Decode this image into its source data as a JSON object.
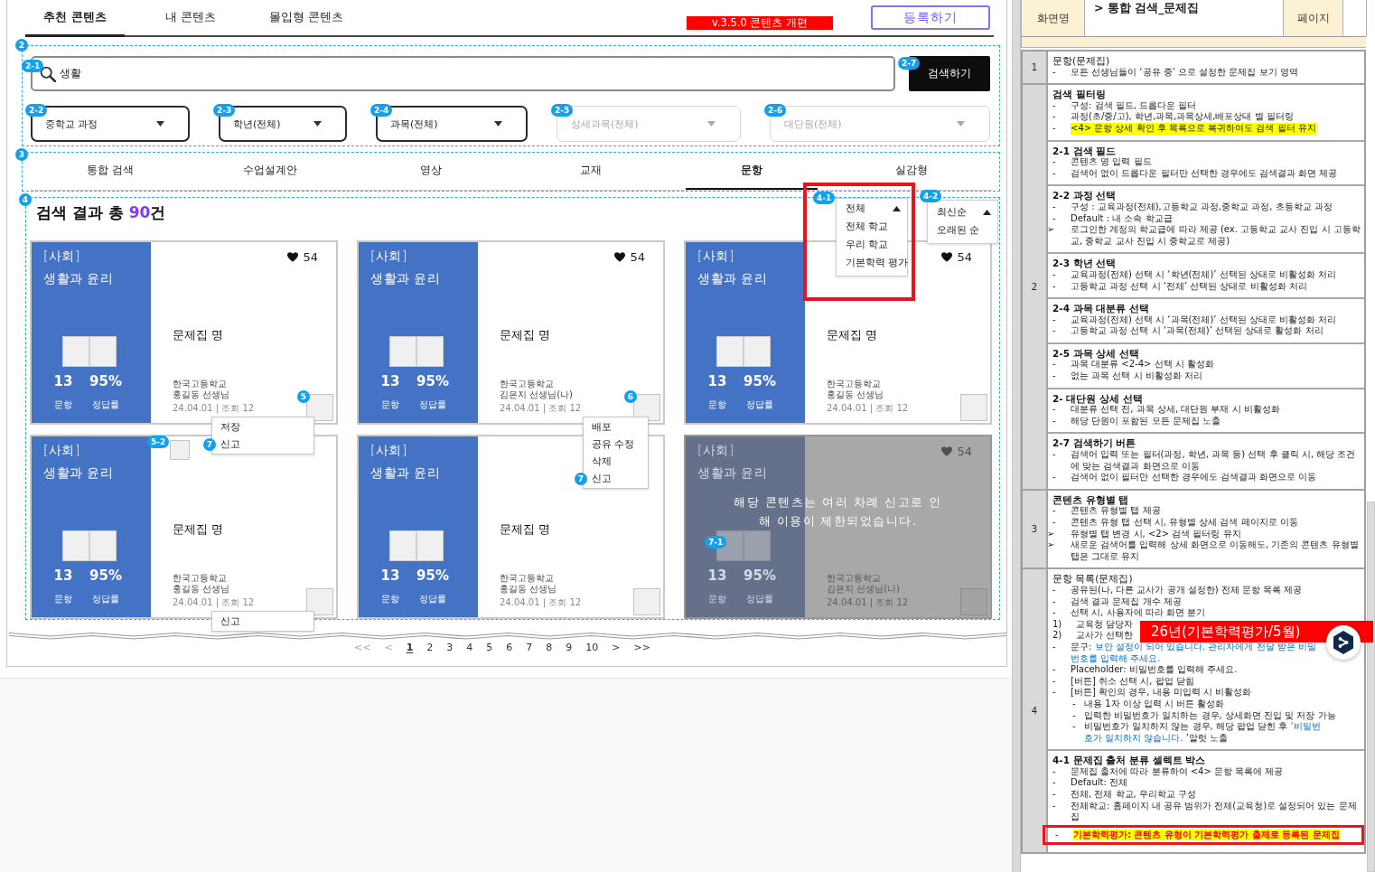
{
  "top_tabs": [
    {
      "label": "추천 콘텐츠",
      "selected": true
    },
    {
      "label": "내 콘텐츠",
      "selected": false
    },
    {
      "label": "몰입형 콘텐츠",
      "selected": false
    }
  ],
  "version_label": "v.3.5.0 콘텐츠 개편",
  "register_button": "등록하기",
  "search_area": {
    "badge": "2",
    "search_field": {
      "badge": "2-1",
      "value": "생활"
    },
    "search_button": {
      "badge": "2-7",
      "label": "검색하기"
    },
    "filters": [
      {
        "badge": "2-2",
        "value": "중학교 과정",
        "disabled": false
      },
      {
        "badge": "2-3",
        "value": "학년(전체)",
        "disabled": false
      },
      {
        "badge": "2-4",
        "value": "과목(전체)",
        "disabled": false
      },
      {
        "badge": "2-5",
        "value": "상세과목(전체)",
        "disabled": true
      },
      {
        "badge": "2-6",
        "value": "대단원(전체)",
        "disabled": true
      }
    ]
  },
  "type_tabs": {
    "badge": "3",
    "tabs": [
      {
        "label": "통합 검색",
        "selected": false
      },
      {
        "label": "수업설계안",
        "selected": false
      },
      {
        "label": "영상",
        "selected": false
      },
      {
        "label": "교재",
        "selected": false
      },
      {
        "label": "문항",
        "selected": true
      },
      {
        "label": "실감형",
        "selected": false
      }
    ]
  },
  "results": {
    "badge": "4",
    "summary": {
      "prefix": "검색 결과 총 ",
      "count": "90",
      "suffix": "건"
    },
    "source_select": {
      "badge": "4-1",
      "value": "전체",
      "expanded": true,
      "options": [
        "전체 학교",
        "우리 학교",
        "기본학력 평가"
      ]
    },
    "sort_select": {
      "badge": "4-2",
      "value": "최신순",
      "expanded": true,
      "options": [
        "오래된 순"
      ]
    },
    "cards": [
      {
        "subject": "[사회]",
        "title": "생활과 윤리",
        "question_count": "13",
        "accuracy": "95%",
        "question_label": "문항",
        "accuracy_label": "정답률",
        "likes": "54",
        "name": "문제집 명",
        "school": "한국고등학교",
        "teacher": "홍길동 선생님",
        "meta": "24.04.01 | 조회 12",
        "restricted": false,
        "square_badge": "5",
        "menu": {
          "items": [
            {
              "label": "저장"
            },
            {
              "label": "신고",
              "badge": "7"
            }
          ]
        }
      },
      {
        "subject": "[사회]",
        "title": "생활과 윤리",
        "question_count": "13",
        "accuracy": "95%",
        "question_label": "문항",
        "accuracy_label": "정답률",
        "likes": "54",
        "name": "문제집 명",
        "school": "한국고등학교",
        "teacher": "김은지 선생님(나)",
        "meta": "24.04.01 | 조회 12",
        "restricted": false,
        "square_badge": "6",
        "menu": {
          "items": [
            {
              "label": "배포"
            },
            {
              "label": "공유 수정"
            },
            {
              "label": "삭제"
            },
            {
              "label": "신고",
              "badge": "7"
            }
          ]
        }
      },
      {
        "subject": "[사회]",
        "title": "생활과 윤리",
        "question_count": "13",
        "accuracy": "95%",
        "question_label": "문항",
        "accuracy_label": "정답률",
        "likes": "54",
        "name": "문제집 명",
        "school": "한국고등학교",
        "teacher": "홍길동 선생님",
        "meta": "24.04.01 | 조회 12",
        "restricted": false
      },
      {
        "subject": "[사회]",
        "title": "생활과 윤리",
        "question_count": "13",
        "accuracy": "95%",
        "question_label": "문항",
        "accuracy_label": "정답률",
        "name": "문제집 명",
        "school": "한국고등학교",
        "teacher": "홍길동 선생님",
        "meta": "24.04.01 | 조회 12",
        "restricted": false,
        "corner_box": {
          "badge": "5-2"
        },
        "menu": {
          "items": [
            {
              "label": "신고"
            }
          ]
        }
      },
      {
        "subject": "[사회]",
        "title": "생활과 윤리",
        "question_count": "13",
        "accuracy": "95%",
        "question_label": "문항",
        "accuracy_label": "정답률",
        "name": "문제집 명",
        "school": "한국고등학교",
        "teacher": "홍길동 선생님",
        "meta": "24.04.01 | 조회 12",
        "restricted": false
      },
      {
        "subject": "[사회]",
        "title": "생활과 윤리",
        "question_count": "13",
        "accuracy": "95%",
        "question_label": "문항",
        "accuracy_label": "정답률",
        "likes": "54",
        "school": "한국고등학교",
        "teacher": "김은지 선생님(나)",
        "meta": "24.04.01 | 조회 12",
        "restricted": true,
        "notice": {
          "badge": "7-1",
          "text": "해당 콘텐츠는 여러 차례 신고로 인해 이용이 제한되었습니다."
        }
      }
    ]
  },
  "pagination": {
    "first": "<<",
    "prev": "<",
    "pages": [
      {
        "label": "1",
        "selected": true
      },
      {
        "label": "2",
        "selected": false
      },
      {
        "label": "3",
        "selected": false
      },
      {
        "label": "4",
        "selected": false
      },
      {
        "label": "5",
        "selected": false
      },
      {
        "label": "6",
        "selected": false
      },
      {
        "label": "7",
        "selected": false
      },
      {
        "label": "8",
        "selected": false
      },
      {
        "label": "9",
        "selected": false
      },
      {
        "label": "10",
        "selected": false
      }
    ],
    "next": ">",
    "last": ">>"
  },
  "spec_sheet": {
    "header": {
      "screen_label": "화면명",
      "screen_name": "> 통합 검색_문제집",
      "page_label": "페이지"
    },
    "rows": [
      {
        "number": "1",
        "blocks": [
          {
            "title": "문항(문제집)",
            "bold": false,
            "items": [
              {
                "kind": "dash",
                "marker": "-",
                "text": "모든 선생님들이 ‘공유 중’ 으로 설정한 문제집 보기 영역"
              }
            ]
          }
        ]
      },
      {
        "number": "2",
        "blocks": [
          {
            "title": "검색 필터링",
            "bold": true,
            "items": [
              {
                "kind": "dash",
                "marker": "-",
                "text": "구성: 검색 필드, 드롭다운 필터"
              },
              {
                "kind": "dash",
                "marker": "-",
                "text": "과정(초/중/고), 학년,과목,과목상세,배포상태 별 필터링"
              },
              {
                "kind": "highlight",
                "marker": "-",
                "text": "<4> 문항 상세 확인 후 목록으로 복귀하여도 검색 필터 유지"
              }
            ]
          },
          {
            "title": "2-1 검색 필드",
            "bold": true,
            "items": [
              {
                "kind": "dash",
                "marker": "-",
                "text": "콘텐츠 명 입력 필드"
              },
              {
                "kind": "dash",
                "marker": "-",
                "text": "검색어 없이 드롭다운 필터만 선택한 경우에도 검색결과 화면 제공"
              }
            ]
          },
          {
            "title": "2-2 과정 선택",
            "bold": true,
            "items": [
              {
                "kind": "dash",
                "marker": "-",
                "text": "구성 : 교육과정(전체),고등학교 과정,중학교 과정, 초등학교 과정"
              },
              {
                "kind": "dash",
                "marker": "-",
                "text": "Default : 내 소속 학교급"
              },
              {
                "kind": "arrow",
                "marker": "➢",
                "text": "로그인한 계정의 학교급에 따라 제공 (ex. 고등학교 교사 진입 시 고등학교, 중학교 교사 진입 시 중학교로 제공)"
              }
            ]
          },
          {
            "title": "2-3 학년 선택",
            "bold": true,
            "items": [
              {
                "kind": "dash",
                "marker": "-",
                "text": "교육과정(전체) 선택 시 ‘학년(전체)’ 선택된 상태로 비활성화 처리"
              },
              {
                "kind": "dash",
                "marker": "-",
                "text": "고등학교 과정 선택 시 ‘전체’ 선택된 상태로 비활성화 처리"
              }
            ]
          },
          {
            "title": "2-4 과목 대분류 선택",
            "bold": true,
            "items": [
              {
                "kind": "dash",
                "marker": "-",
                "text": "교육과정(전체) 선택 시 ‘과목(전체)’ 선택된 상태로 비활성화 처리"
              },
              {
                "kind": "dash",
                "marker": "-",
                "text": "고등학교 과정 선택 시 ‘과목(전체)’ 선택된 상태로 활성화 처리"
              }
            ]
          },
          {
            "title": "2-5 과목 상세 선택",
            "bold": true,
            "items": [
              {
                "kind": "dash",
                "marker": "-",
                "text": "과목 대분류 <2-4> 선택 시 활성화"
              },
              {
                "kind": "dash",
                "marker": "-",
                "text": "없는 과목 선택 시 비활성화 처리"
              }
            ]
          },
          {
            "title": "2- 대단원 상세 선택",
            "bold": true,
            "items": [
              {
                "kind": "dash",
                "marker": "-",
                "text": "대분류 선택 전, 과목 상세, 대단원 부재 시 비활성화"
              },
              {
                "kind": "dash",
                "marker": "-",
                "text": "해당 단원이 포함된 모든 문제집 노출"
              }
            ]
          },
          {
            "title": "2-7 검색하기 버튼",
            "bold": true,
            "items": [
              {
                "kind": "dash",
                "marker": "-",
                "text": "검색어 입력 또는 필터(과정, 학년, 과목 등) 선택 후 클릭 시, 해당 조건에 맞는 검색결과 화면으로 이동"
              },
              {
                "kind": "dash",
                "marker": "-",
                "text": "검색어 없이 필터만 선택한 경우에도 검색결과 화면으로 이동"
              }
            ]
          }
        ]
      },
      {
        "number": "3",
        "blocks": [
          {
            "title": "콘텐츠 유형별 탭",
            "bold": true,
            "items": [
              {
                "kind": "dash",
                "marker": "-",
                "text": "콘텐츠 유형별 탭 제공"
              },
              {
                "kind": "dash",
                "marker": "-",
                "text": "콘텐츠 유형 탭 선택 시, 유형별 상세 검색 페이지로 이동"
              },
              {
                "kind": "arrow",
                "marker": "➢",
                "text": "유형별 탭 변경 시, <2> 검색 필터링 유지"
              },
              {
                "kind": "arrow",
                "marker": "➢",
                "text": "새로운 검색어를 입력해 상세 화면으로 이동해도, 기존의 콘텐츠 유형별 탭은 그대로 유지"
              }
            ]
          }
        ]
      },
      {
        "number": "4",
        "blocks": [
          {
            "title": "문항 목록(문제집)",
            "bold": false,
            "banner": "26년(기본학력평가/5월)",
            "items": [
              {
                "kind": "dash",
                "marker": "-",
                "text": "공유된(나, 다른 교사가 공개 설정한) 전체 문항 목록 제공"
              },
              {
                "kind": "dash",
                "marker": "-",
                "text": "검색 결과 문제집 개수 제공"
              },
              {
                "kind": "dash",
                "marker": "-",
                "text": "선택 시, 사용자에 따라 화면 분기"
              },
              {
                "kind": "numbered",
                "marker": "1)",
                "text": "교육청 담당자"
              },
              {
                "kind": "numbered",
                "marker": "2)",
                "text": "교사가 선택한"
              },
              {
                "kind": "dash",
                "marker": "-",
                "segments": [
                  {
                    "text": "문구: ",
                    "quoted": false
                  },
                  {
                    "text": "보안 설정이 되어 있습니다. 관리자에게 전달 받은 비밀번호를 입력해 주세요.",
                    "quoted": true
                  }
                ]
              },
              {
                "kind": "dash",
                "marker": "-",
                "text": "Placeholder: 비밀번호를 입력해 주세요."
              },
              {
                "kind": "dash",
                "marker": "-",
                "text": "[버튼] 취소 선택 시, 팝업 닫힘"
              },
              {
                "kind": "dash",
                "marker": "-",
                "text": "[버튼] 확인의 경우, 내용 미입력 시 비활성화",
                "children": [
                  {
                    "kind": "dash",
                    "marker": "-",
                    "text": "내용 1자 이상 입력 시 버튼 활성화"
                  },
                  {
                    "kind": "dash",
                    "marker": "-",
                    "text": "입력한 비밀번호가 일치하는 경우, 상세화면 진입 및 저장 가능"
                  },
                  {
                    "kind": "dash",
                    "marker": "-",
                    "segments": [
                      {
                        "text": "비밀번호가 일치하지 않는 경우, 해당 팝업 닫힌 후 ",
                        "quoted": false
                      },
                      {
                        "text": "‘비밀번호가 일치하지 않습니다.",
                        "quoted": true
                      },
                      {
                        "text": " ’알럿 노출",
                        "quoted": false
                      }
                    ]
                  }
                ]
              }
            ]
          },
          {
            "title": "4-1 문제집 출처 분류 셀렉트 박스",
            "bold": true,
            "items": [
              {
                "kind": "dash",
                "marker": "-",
                "text": "문제집 출처에 따라 분류하여 <4> 문항 목록에 제공"
              },
              {
                "kind": "dash",
                "marker": "-",
                "text": "Default: 전체"
              },
              {
                "kind": "dash",
                "marker": "-",
                "text": "전체, 전체 학교, 우리학교 구성"
              },
              {
                "kind": "dash",
                "marker": "-",
                "text": "전체학교: 홈페이지 내 공유 범위가 전체(교육청)로 설정되어 있는 문제집"
              },
              {
                "kind": "alert",
                "marker": "-",
                "text": "기본학력평가: 콘텐츠 유형이 기본학력평가 출제로 등록된 문제집"
              }
            ]
          }
        ]
      }
    ]
  }
}
